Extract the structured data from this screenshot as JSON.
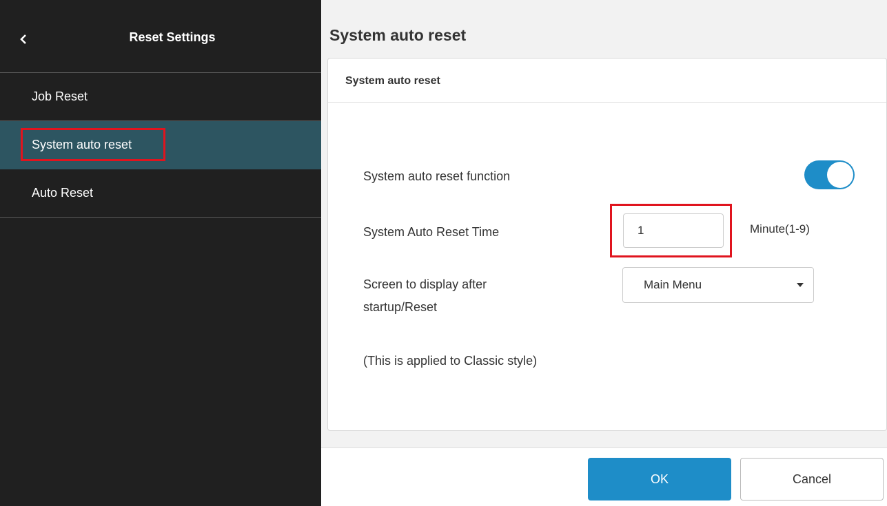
{
  "sidebar": {
    "back_icon": "chevron-left-icon",
    "title": "Reset Settings",
    "items": [
      {
        "label": "Job Reset",
        "active": false
      },
      {
        "label": "System auto reset",
        "active": true
      },
      {
        "label": "Auto Reset",
        "active": false
      }
    ]
  },
  "main": {
    "page_title": "System auto reset",
    "card_title": "System auto reset",
    "fields": {
      "function_label": "System auto reset function",
      "function_enabled": true,
      "time_label": "System Auto Reset Time",
      "time_value": "1",
      "time_unit": "Minute(1-9)",
      "screen_label_line1": "Screen to display after",
      "screen_label_line2": "startup/Reset",
      "screen_value": "Main Menu",
      "note": "(This is applied to Classic style)"
    }
  },
  "footer": {
    "ok_label": "OK",
    "cancel_label": "Cancel"
  },
  "colors": {
    "sidebar_bg": "#202020",
    "active_item_bg": "#2d5561",
    "accent": "#1e8dc8",
    "highlight": "#e0141e"
  }
}
